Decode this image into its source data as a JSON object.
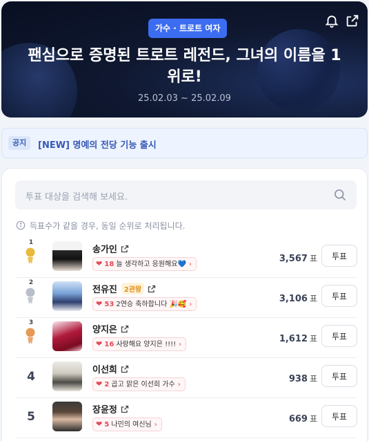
{
  "header": {
    "category_badge": "가수 · 트로트 여자",
    "title": "팬심으로 증명된 트로트 레전드, 그녀의 이름을 1위로!",
    "date_range": "25.02.03 ~ 25.02.09",
    "icons": [
      "bell-icon",
      "share-icon"
    ]
  },
  "notice": {
    "tag": "공지",
    "text": "[NEW] 명예의 전당 기능 출시"
  },
  "search": {
    "placeholder": "투표 대상을 검색해 보세요."
  },
  "tie_info": "득표수가 같을 경우, 동일 순위로 처리됩니다.",
  "vote_button_label": "투표",
  "vote_unit": "표",
  "colors": {
    "accent": "#3c6cf0",
    "heart": "#e24b57",
    "gold": "#e8b93a",
    "silver": "#b9bfca",
    "bronze": "#e59a55"
  },
  "rankings": [
    {
      "rank": "1",
      "medal": "gold",
      "name": "송가인",
      "extra_tag": "",
      "cheer_count": "18",
      "cheer_text": "늘 생각하고 응원해요💙",
      "votes": "3,567"
    },
    {
      "rank": "2",
      "medal": "silver",
      "name": "전유진",
      "extra_tag": "2관왕",
      "cheer_count": "53",
      "cheer_text": "2연승 축하합니다 🎉🥰",
      "votes": "3,106"
    },
    {
      "rank": "3",
      "medal": "bronze",
      "name": "양지은",
      "extra_tag": "",
      "cheer_count": "16",
      "cheer_text": "사랑해요 양지은 !!!!",
      "votes": "1,612"
    },
    {
      "rank": "4",
      "medal": "",
      "name": "이선희",
      "extra_tag": "",
      "cheer_count": "2",
      "cheer_text": "곱고 맑은 이선희 가수",
      "votes": "938"
    },
    {
      "rank": "5",
      "medal": "",
      "name": "장윤정",
      "extra_tag": "",
      "cheer_count": "5",
      "cheer_text": "나민의 여신님",
      "votes": "669"
    }
  ]
}
